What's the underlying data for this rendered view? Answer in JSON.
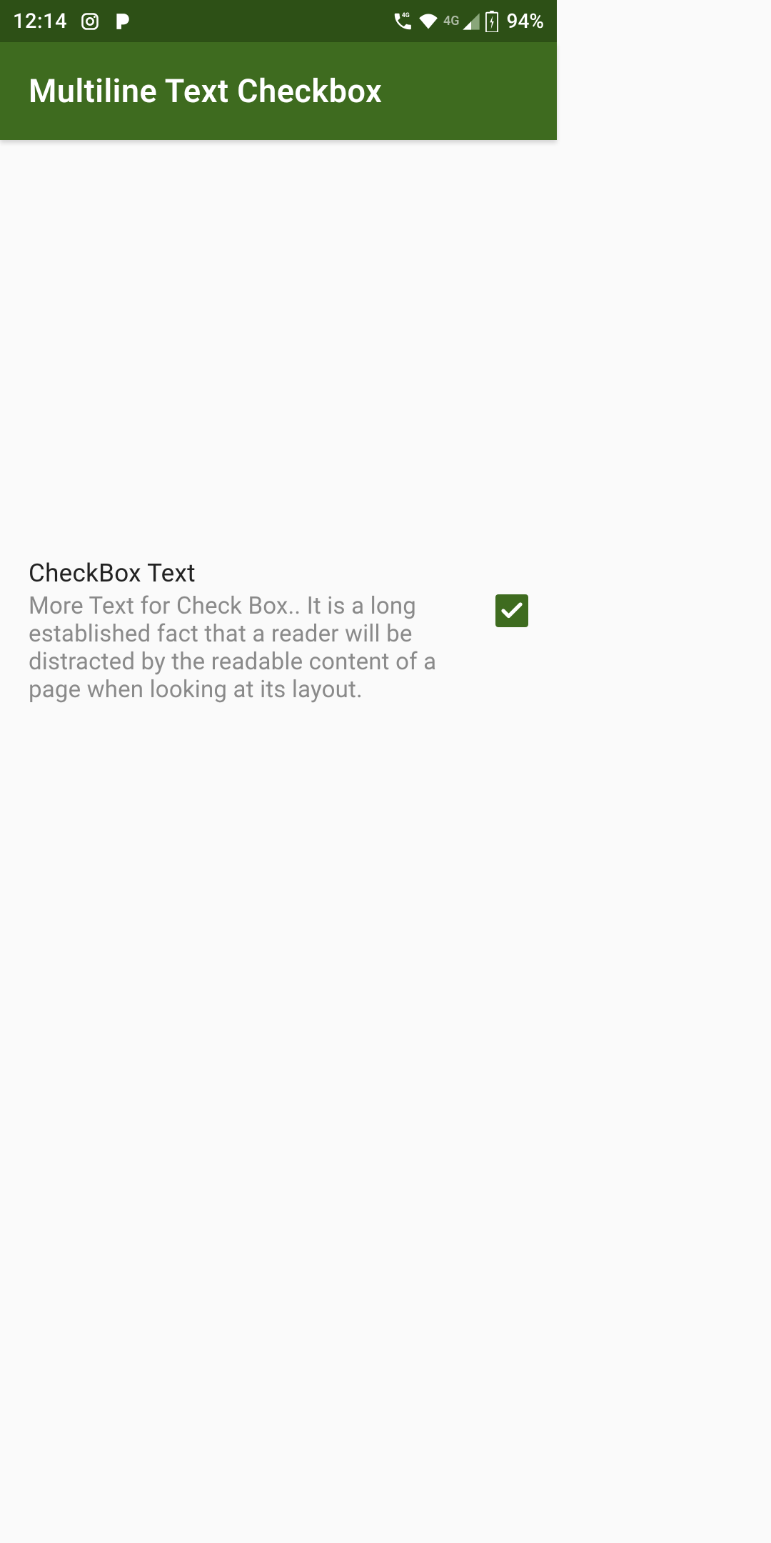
{
  "status": {
    "time": "12:14",
    "battery": "94%",
    "network_label": "4G"
  },
  "appbar": {
    "title": "Multiline Text Checkbox"
  },
  "checkbox": {
    "title": "CheckBox Text",
    "description": "More Text for Check Box.. It is a long established fact that a reader will be distracted by the readable content of a page when looking at its layout.",
    "checked": true
  }
}
